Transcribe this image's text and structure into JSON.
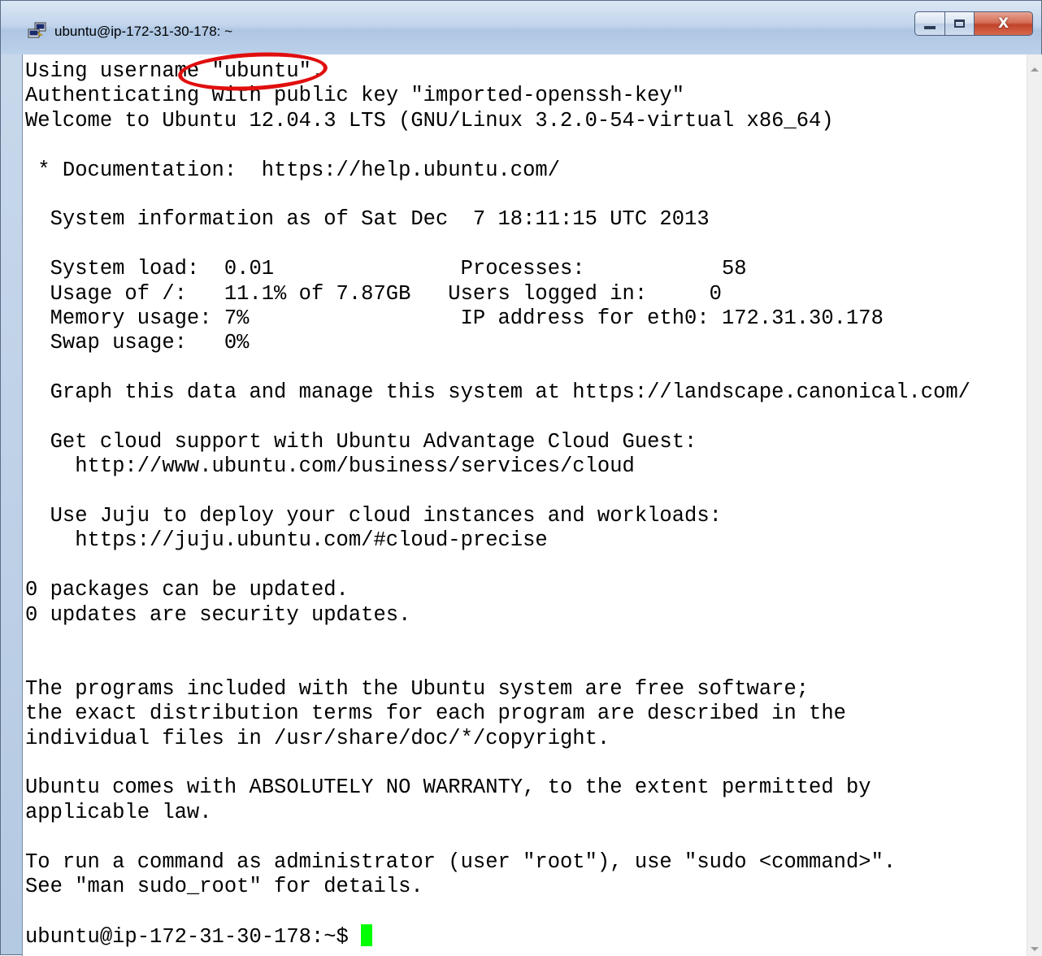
{
  "window": {
    "title": "ubuntu@ip-172-31-30-178: ~",
    "close_label": "X"
  },
  "terminal": {
    "lines": [
      "Using username \"ubuntu\".",
      "Authenticating with public key \"imported-openssh-key\"",
      "Welcome to Ubuntu 12.04.3 LTS (GNU/Linux 3.2.0-54-virtual x86_64)",
      "",
      " * Documentation:  https://help.ubuntu.com/",
      "",
      "  System information as of Sat Dec  7 18:11:15 UTC 2013",
      "",
      "  System load:  0.01               Processes:           58",
      "  Usage of /:   11.1% of 7.87GB   Users logged in:     0",
      "  Memory usage: 7%                 IP address for eth0: 172.31.30.178",
      "  Swap usage:   0%",
      "",
      "  Graph this data and manage this system at https://landscape.canonical.com/",
      "",
      "  Get cloud support with Ubuntu Advantage Cloud Guest:",
      "    http://www.ubuntu.com/business/services/cloud",
      "",
      "  Use Juju to deploy your cloud instances and workloads:",
      "    https://juju.ubuntu.com/#cloud-precise",
      "",
      "0 packages can be updated.",
      "0 updates are security updates.",
      "",
      "",
      "The programs included with the Ubuntu system are free software;",
      "the exact distribution terms for each program are described in the",
      "individual files in /usr/share/doc/*/copyright.",
      "",
      "Ubuntu comes with ABSOLUTELY NO WARRANTY, to the extent permitted by",
      "applicable law.",
      "",
      "To run a command as administrator (user \"root\"), use \"sudo <command>\".",
      "See \"man sudo_root\" for details.",
      ""
    ],
    "prompt": "ubuntu@ip-172-31-30-178:~$ "
  },
  "colors": {
    "cursor": "#00ff00",
    "annotation_circle": "#e10e0e",
    "titlebar": "#c2d5ec"
  },
  "icons": {
    "app": "putty-icon",
    "minimize": "minimize-icon",
    "maximize": "maximize-icon",
    "close": "close-icon"
  }
}
